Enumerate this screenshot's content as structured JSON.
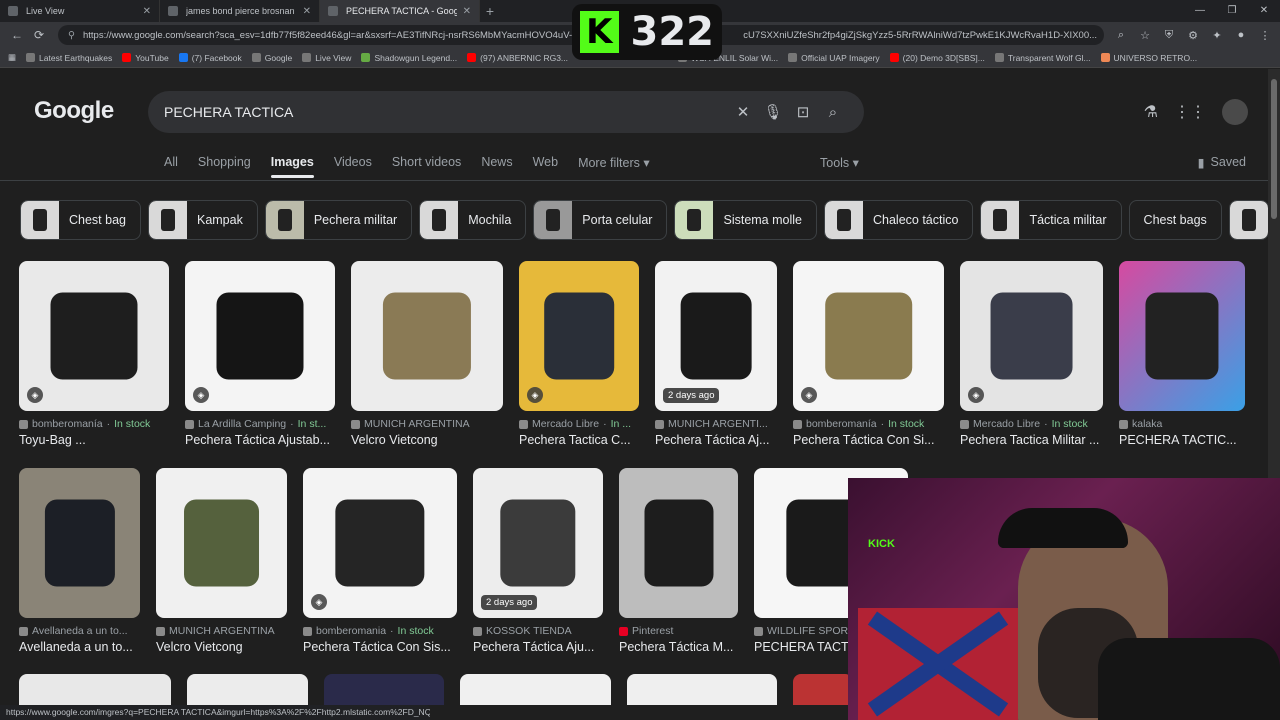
{
  "browser": {
    "tabs": [
      {
        "title": "Live View"
      },
      {
        "title": "james bond pierce brosnan - Goo"
      },
      {
        "title": "PECHERA TACTICA - Google Sear"
      }
    ],
    "url": "https://www.google.com/search?sca_esv=1dfb77f5f82eed46&gl=ar&sxsrf=AE3TifNRcj-nsrRS6MbMYacmHOVO4uV-FQ:1",
    "url_tail": "cU7SXXniUZfeShr2fp4giZjSkgYzz5-5RrRWAlniWd7tzPwkE1KJWcRvaH1D-XIX00...",
    "bookmarks": [
      "Latest Earthquakes",
      "YouTube",
      "(7) Facebook",
      "Google",
      "Live View",
      "Shadowgun Legend...",
      "(97) ANBERNIC RG3...",
      "WSA-ENLIL Solar Wi...",
      "Official UAP Imagery",
      "(20) Demo 3D[SBS]...",
      "Transparent Wolf Gl...",
      "UNIVERSO RETRO..."
    ],
    "status_url": "https://www.google.com/imgres?q=PECHERA TACTICA&imgurl=https%3A%2F%2Fhttp2.mlstatic.com%2FD_NQ_NP_..."
  },
  "kick": {
    "count": "322",
    "logo_letter": "K"
  },
  "google": {
    "logo": "Google",
    "query": "PECHERA TACTICA",
    "tabs": [
      "All",
      "Shopping",
      "Images",
      "Videos",
      "Short videos",
      "News",
      "Web",
      "More filters ▾"
    ],
    "tools": "Tools ▾",
    "saved": "Saved",
    "chips": [
      "Chest bag",
      "Kampak",
      "Pechera militar",
      "Mochila",
      "Porta celular",
      "Sistema molle",
      "Chaleco táctico",
      "Táctica militar",
      "Chest bags"
    ]
  },
  "results_row1": [
    {
      "source": "bomberomanía",
      "stock": "In stock",
      "title": "Toyu-Bag ..."
    },
    {
      "source": "La Ardilla Camping",
      "stock": "In st...",
      "title": "Pechera Táctica Ajustab..."
    },
    {
      "source": "MUNICH ARGENTINA",
      "stock": "",
      "title": "Velcro Vietcong"
    },
    {
      "source": "Mercado Libre",
      "stock": "In ...",
      "title": "Pechera Tactica C..."
    },
    {
      "source": "MUNICH ARGENTI...",
      "stock": "",
      "title": "Pechera Táctica Aj...",
      "age": "2 days ago"
    },
    {
      "source": "bomberomanía",
      "stock": "In stock",
      "title": "Pechera Táctica Con Si..."
    },
    {
      "source": "Mercado Libre",
      "stock": "In stock",
      "title": "Pechera Tactica Militar ..."
    },
    {
      "source": "kalaka",
      "stock": "",
      "title": "PECHERA TACTIC..."
    }
  ],
  "results_row2": [
    {
      "source": "Avellaneda a un to...",
      "stock": "",
      "title": "Avellaneda a un to..."
    },
    {
      "source": "MUNICH ARGENTINA",
      "stock": "",
      "title": "Velcro Vietcong"
    },
    {
      "source": "bomberomania",
      "stock": "In stock",
      "title": "Pechera Táctica Con Sis..."
    },
    {
      "source": "KOSSOK TIENDA",
      "stock": "",
      "title": "Pechera Táctica Aju...",
      "age": "2 days ago"
    },
    {
      "source": "Pinterest",
      "stock": "",
      "title": "Pechera Táctica M..."
    },
    {
      "source": "WILDLIFE SPOR...",
      "stock": "",
      "title": "PECHERA TACT..."
    }
  ],
  "colors": {
    "background": "#1f1f1f",
    "search_box": "#303134",
    "in_stock": "#81c995",
    "kick_green": "#53fc18"
  }
}
